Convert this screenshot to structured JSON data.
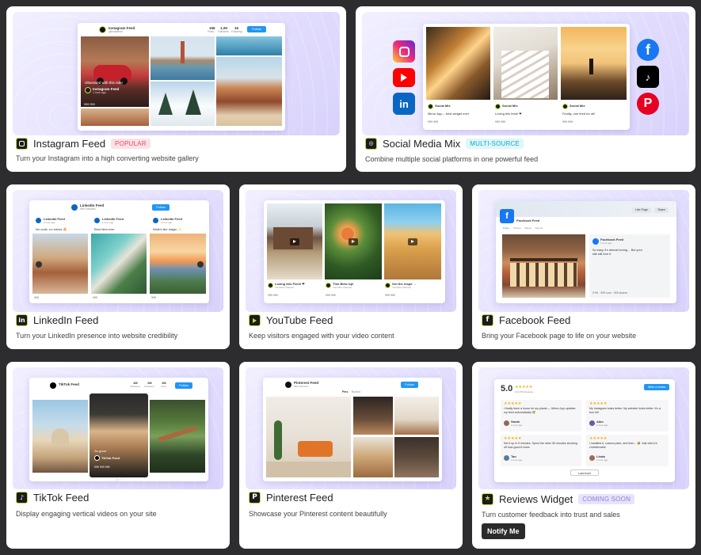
{
  "cards": {
    "instagram": {
      "title": "Instagram Feed",
      "badge": "POPULAR",
      "desc": "Turn your Instagram into a high  converting website gallery",
      "mock": {
        "name": "Instagram Feed",
        "handle": "@instafeed",
        "stats": [
          {
            "v": "156",
            "l": "Posts"
          },
          {
            "v": "1.2K",
            "l": "Followers"
          },
          {
            "v": "16",
            "l": "Following"
          }
        ],
        "follow": "Follow",
        "overlay": "Obsessed with this ride!",
        "post_name": "Instagram Feed",
        "post_time": "1 hour ago",
        "post_counts": "999  999"
      }
    },
    "social": {
      "title": "Social Media Mix",
      "badge": "MULTI-SOURCE",
      "desc": "Combine multiple social platforms in one powerful feed",
      "mock": {
        "posts": [
          {
            "name": "Social Mix",
            "text": "Mirror App – best widget ever",
            "counts": "999  999"
          },
          {
            "name": "Social Mix",
            "text": "Loving this feed! ❤",
            "counts": "999  999"
          },
          {
            "name": "Social Mix",
            "text": "Finally, one feed for all!",
            "counts": "999  999"
          }
        ]
      },
      "platforms": [
        "instagram",
        "youtube",
        "linkedin",
        "facebook",
        "tiktok",
        "pinterest"
      ]
    },
    "linkedin": {
      "title": "LinkedIn Feed",
      "desc": "Turn your LinkedIn presence into website credibility",
      "mock": {
        "name": "LinkedIn Feed",
        "sub": "999 Followers",
        "follow": "Follow",
        "posts": [
          {
            "name": "LinkedIn Feed",
            "time": "1 hour ago",
            "text": "No code, no stress 🔥",
            "counts": "999"
          },
          {
            "name": "LinkedIn Feed",
            "time": "1 hour ago",
            "text": "Best idea ever",
            "counts": "999"
          },
          {
            "name": "LinkedIn Feed",
            "time": "1 hour ago",
            "text": "Walk's like magic ✨",
            "counts": "999"
          }
        ]
      }
    },
    "youtube": {
      "title": "YouTube Feed",
      "desc": "Keep visitors engaged with your video content",
      "mock": {
        "posts": [
          {
            "title": "Loving this Feed! ❤",
            "ch": "YouTube Channel",
            "counts": "999  999"
          },
          {
            "title": "This Blew Up!",
            "ch": "YouTube Channel",
            "counts": "999  999"
          },
          {
            "title": "Get the inspo →",
            "ch": "YouTube Channel",
            "counts": "999  999"
          }
        ]
      }
    },
    "facebook": {
      "title": "Facebook Feed",
      "desc": "Bring your Facebook page to life on your website",
      "mock": {
        "page": "Facebook Feed",
        "like": "Like Page",
        "share": "Share",
        "tabs": [
          "Posts",
          "Photos",
          "Videos",
          "Events"
        ],
        "post_name": "Facebook Feed",
        "post_time": "1 hour ago",
        "post_text": "So easy, it's almost boring…  But your site will love it.",
        "counts": "9.9K · 999 com · 999 shares"
      }
    },
    "tiktok": {
      "title": "TikTok Feed",
      "desc": "Display engaging vertical videos on your site",
      "mock": {
        "name": "TikTok Feed",
        "stats": [
          {
            "v": "1M",
            "l": "Following"
          },
          {
            "v": "1M",
            "l": "Followers"
          },
          {
            "v": "1M",
            "l": "Likes"
          }
        ],
        "follow": "Follow",
        "post_name": "TikTok Feed",
        "post_text": "So good",
        "counts": "999  999  999"
      }
    },
    "pinterest": {
      "title": "Pinterest Feed",
      "desc": "Showcase your Pinterest content beautifully",
      "mock": {
        "name": "Pinterest Feed",
        "sub": "999 Followers",
        "follow": "Follow",
        "tabs": [
          "Pins",
          "Boards"
        ]
      }
    },
    "reviews": {
      "title": "Reviews Widget",
      "badge": "COMING SOON",
      "desc": "Turn customer feedback into trust and sales",
      "notify": "Notify Me",
      "mock": {
        "score": "5.0",
        "count": "123,079 Reviews",
        "write": "Write a review",
        "load": "Load more",
        "reviews": [
          {
            "text": "I finally have a home for my plants — Mirror App updates my feed automatically 🌿",
            "name": "Sarah",
            "time": "1 hour ago"
          },
          {
            "text": "My Instagram looks better. My website looks better. It's a true hit!",
            "name": "Aiko",
            "time": "1 hour ago"
          },
          {
            "text": "Set it up in 5 minutes. Spent the other 55 minutes showing off how good it looks",
            "name": "Tan",
            "time": "1 hour ago"
          },
          {
            "text": "I installed it, custom paint, and then... 🤣 Just vibe'd it. Unbelievable.",
            "name": "Linda",
            "time": "1 hour ago"
          }
        ]
      }
    }
  }
}
